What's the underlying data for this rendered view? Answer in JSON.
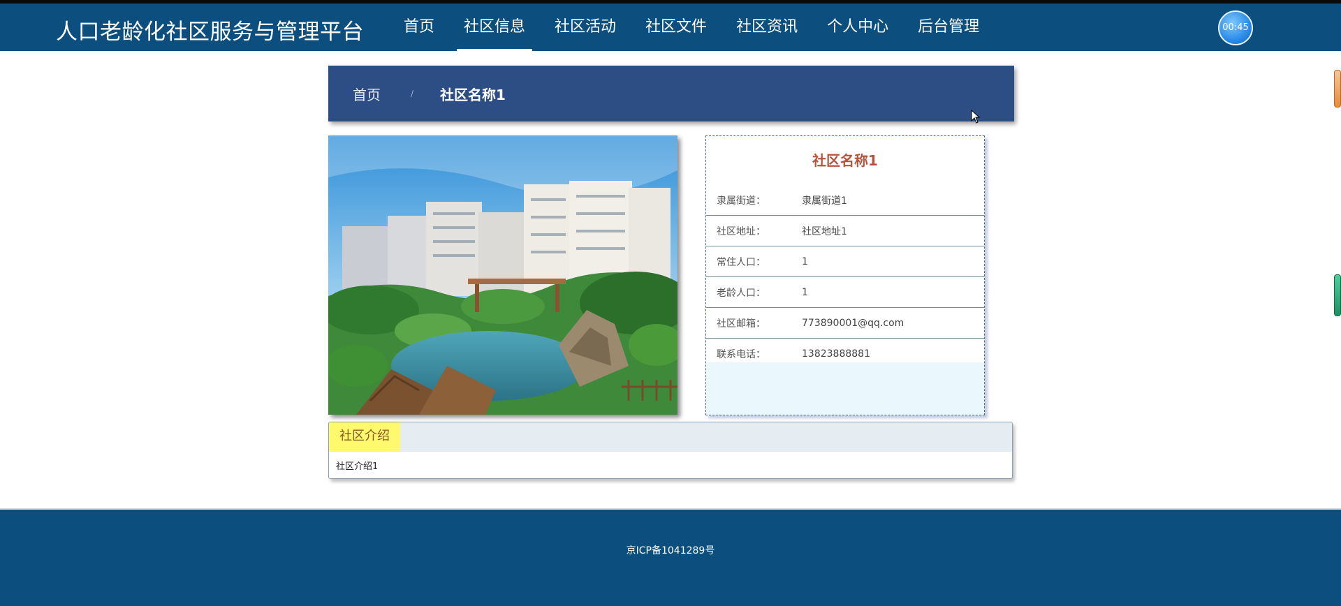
{
  "header": {
    "site_title": "人口老龄化社区服务与管理平台",
    "nav": [
      "首页",
      "社区信息",
      "社区活动",
      "社区文件",
      "社区资讯",
      "个人中心",
      "后台管理"
    ],
    "active_nav_index": 1,
    "timer": "00:45"
  },
  "breadcrumb": {
    "home": "首页",
    "separator": "/",
    "current": "社区名称1"
  },
  "community": {
    "name": "社区名称1",
    "fields": [
      {
        "label": "隶属街道：",
        "value": "隶属街道1"
      },
      {
        "label": "社区地址：",
        "value": "社区地址1"
      },
      {
        "label": "常住人口：",
        "value": "1"
      },
      {
        "label": "老龄人口：",
        "value": "1"
      },
      {
        "label": "社区邮箱：",
        "value": "773890001@qq.com"
      },
      {
        "label": "联系电话：",
        "value": "13823888881"
      }
    ]
  },
  "intro": {
    "tab_label": "社区介绍",
    "content": "社区介绍1"
  },
  "footer": {
    "icp": "京ICP备1041289号"
  },
  "colors": {
    "header_bg": "#0c4f7e",
    "breadcrumb_bg": "#2c4e85",
    "title_accent": "#b4543c",
    "intro_tab_bg": "#fff96e"
  }
}
